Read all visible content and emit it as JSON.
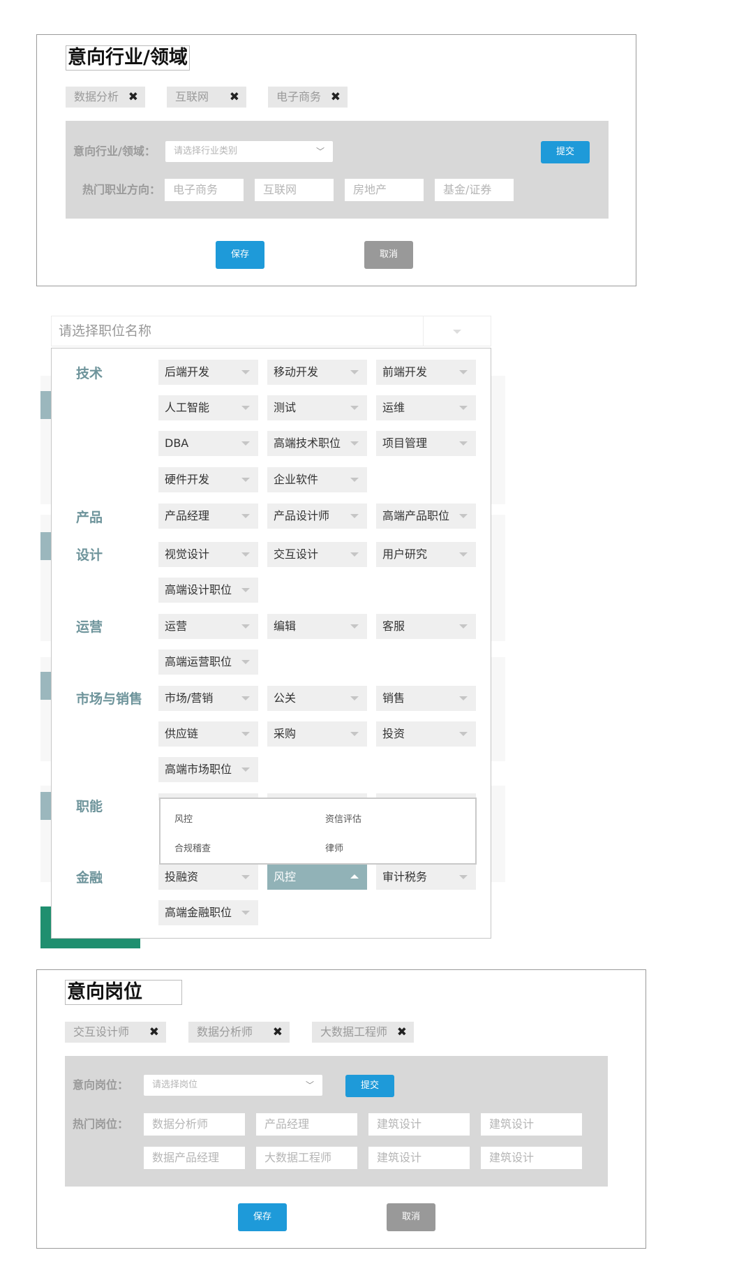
{
  "industry": {
    "title": "意向行业/领域",
    "tags": [
      "数据分析",
      "互联网",
      "电子商务"
    ],
    "tag_remove": "✖",
    "select_label": "意向行业/领域：",
    "select_placeholder": "请选择行业类别",
    "submit": "提交",
    "hot_label": "热门职业方向：",
    "hot": [
      "电子商务",
      "互联网",
      "房地产",
      "基金/证券"
    ],
    "save": "保存",
    "cancel": "取消"
  },
  "job_dropdown": {
    "placeholder": "请选择职位名称",
    "categories": [
      {
        "name": "技术",
        "items": [
          "后端开发",
          "移动开发",
          "前端开发",
          "人工智能",
          "测试",
          "运维",
          "DBA",
          "高端技术职位",
          "项目管理",
          "硬件开发",
          "企业软件"
        ]
      },
      {
        "name": "产品",
        "items": [
          "产品经理",
          "产品设计师",
          "高端产品职位"
        ]
      },
      {
        "name": "设计",
        "items": [
          "视觉设计",
          "交互设计",
          "用户研究",
          "高端设计职位"
        ]
      },
      {
        "name": "运营",
        "items": [
          "运营",
          "编辑",
          "客服",
          "高端运营职位"
        ]
      },
      {
        "name": "市场与销售",
        "items": [
          "市场/营销",
          "公关",
          "销售",
          "供应链",
          "采购",
          "投资",
          "高端市场职位"
        ]
      },
      {
        "name": "职能",
        "items": []
      },
      {
        "name": "金融",
        "items": [
          "投融资",
          "风控",
          "审计税务",
          "高端金融职位"
        ]
      }
    ],
    "submenu": [
      "风控",
      "资信评估",
      "合规稽查",
      "律师"
    ]
  },
  "position": {
    "title": "意向岗位",
    "tags": [
      "交互设计师",
      "数据分析师",
      "大数据工程师"
    ],
    "tag_remove": "✖",
    "select_label": "意向岗位：",
    "select_placeholder": "请选择岗位",
    "select_chevron": "﹀",
    "submit": "提交",
    "hot_label": "热门岗位：",
    "hot": [
      "数据分析师",
      "产品经理",
      "建筑设计",
      "建筑设计",
      "数据产品经理",
      "大数据工程师",
      "建筑设计",
      "建筑设计"
    ],
    "save": "保存",
    "cancel": "取消"
  }
}
